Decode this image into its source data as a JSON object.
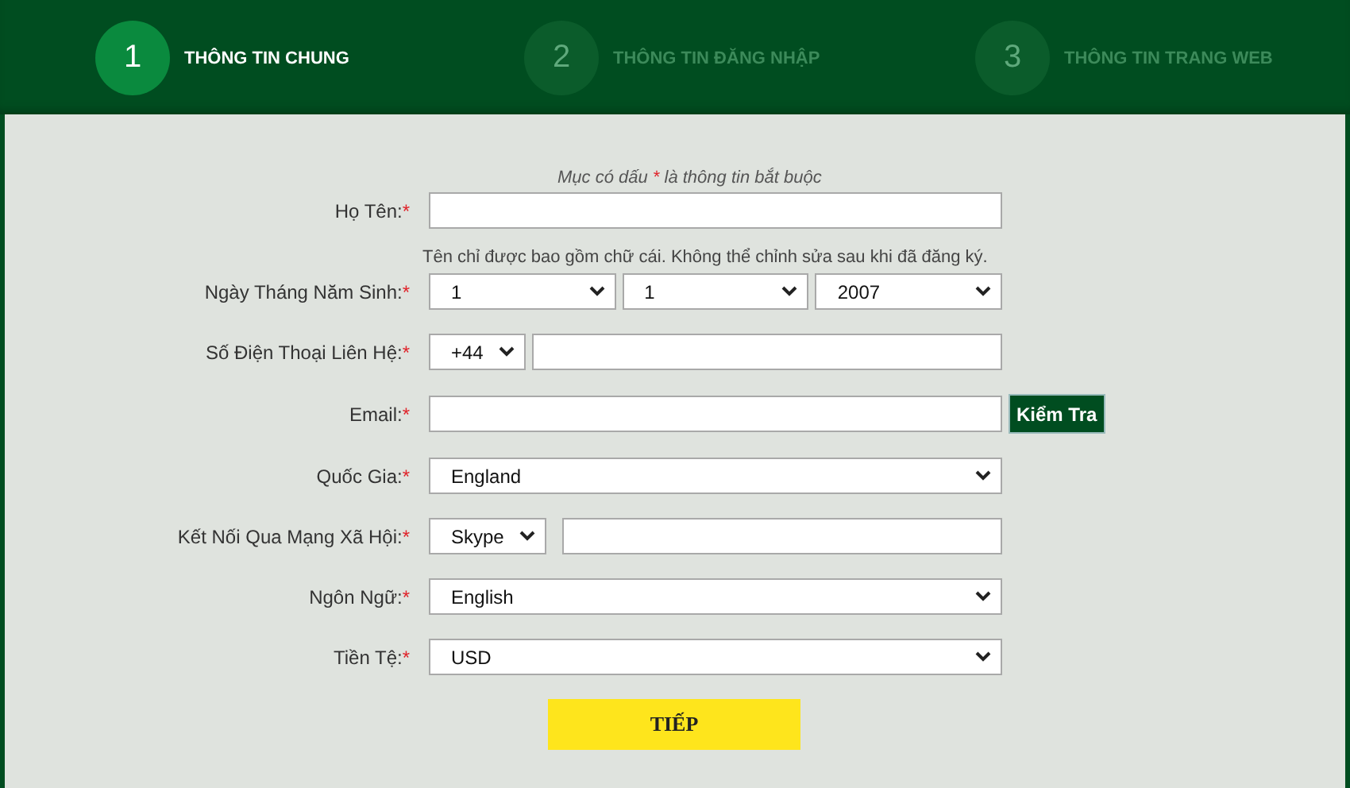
{
  "steps": [
    {
      "number": "1",
      "label": "THÔNG TIN CHUNG",
      "selected": true
    },
    {
      "number": "2",
      "label": "THÔNG TIN ĐĂNG NHẬP",
      "selected": false
    },
    {
      "number": "3",
      "label": "THÔNG TIN TRANG WEB",
      "selected": false
    }
  ],
  "form": {
    "note": {
      "before": "Mục có dấu ",
      "mark": "*",
      "after": " là thông tin bắt buộc"
    },
    "rows": [
      {
        "label": "Họ Tên:",
        "required": true,
        "controls": [
          {
            "kind": "text"
          }
        ],
        "hint": "Tên chỉ được bao gồm chữ cái. Không thể chỉnh sửa sau khi đã đăng ký."
      },
      {
        "label": "Ngày Tháng Năm Sinh:",
        "required": true,
        "controls": [
          {
            "kind": "select",
            "value": "1"
          },
          {
            "kind": "select",
            "value": "1"
          },
          {
            "kind": "select",
            "value": "2007"
          }
        ]
      },
      {
        "label": "Số Điện Thoại Liên Hệ:",
        "required": true,
        "controls": [
          {
            "kind": "select-compact",
            "value": "+44"
          },
          {
            "kind": "text"
          }
        ]
      },
      {
        "label": "Email:",
        "required": true,
        "controls": [
          {
            "kind": "text"
          }
        ],
        "action": "Kiểm Tra"
      },
      {
        "label": "Quốc Gia:",
        "required": true,
        "controls": [
          {
            "kind": "select",
            "value": "England"
          }
        ]
      },
      {
        "label": "Kết Nối Qua Mạng Xã Hội:",
        "required": true,
        "controls": [
          {
            "kind": "select-compact",
            "value": "Skype"
          },
          {
            "kind": "text"
          }
        ]
      },
      {
        "label": "Ngôn Ngữ:",
        "required": true,
        "controls": [
          {
            "kind": "select",
            "value": "English"
          }
        ]
      },
      {
        "label": "Tiền Tệ:",
        "required": true,
        "controls": [
          {
            "kind": "select",
            "value": "USD"
          }
        ]
      }
    ],
    "submit": "TIẾP"
  }
}
